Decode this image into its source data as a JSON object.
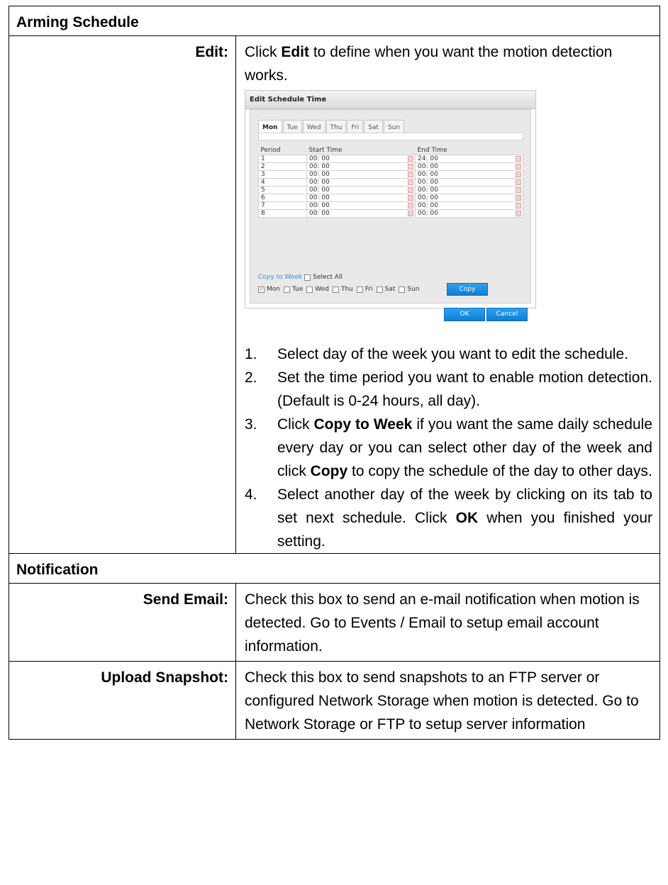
{
  "arming": {
    "header": "Arming Schedule",
    "edit_label": "Edit:",
    "edit_desc_pre": "Click ",
    "edit_desc_bold": "Edit",
    "edit_desc_post": " to define when you want the motion detection works.",
    "dialog": {
      "title": "Edit Schedule Time",
      "tabs": [
        "Mon",
        "Tue",
        "Wed",
        "Thu",
        "Fri",
        "Sat",
        "Sun"
      ],
      "active_tab": "Mon",
      "columns": [
        "Period",
        "Start Time",
        "End Time"
      ],
      "rows": [
        {
          "period": "1",
          "start": "00: 00",
          "end": "24: 00"
        },
        {
          "period": "2",
          "start": "00: 00",
          "end": "00: 00"
        },
        {
          "period": "3",
          "start": "00: 00",
          "end": "00: 00"
        },
        {
          "period": "4",
          "start": "00: 00",
          "end": "00: 00"
        },
        {
          "period": "5",
          "start": "00: 00",
          "end": "00: 00"
        },
        {
          "period": "6",
          "start": "00: 00",
          "end": "00: 00"
        },
        {
          "period": "7",
          "start": "00: 00",
          "end": "00: 00"
        },
        {
          "period": "8",
          "start": "00: 00",
          "end": "00: 00"
        }
      ],
      "copy_to_week": "Copy to Week",
      "select_all": "Select All",
      "days": [
        {
          "label": "Mon",
          "checked": true
        },
        {
          "label": "Tue",
          "checked": false
        },
        {
          "label": "Wed",
          "checked": false
        },
        {
          "label": "Thu",
          "checked": false
        },
        {
          "label": "Fri",
          "checked": false
        },
        {
          "label": "Sat",
          "checked": false
        },
        {
          "label": "Sun",
          "checked": false
        }
      ],
      "copy_button": "Copy",
      "ok_button": "OK",
      "cancel_button": "Cancel"
    },
    "steps": [
      {
        "num": "1.",
        "parts": [
          {
            "t": "Select day of the week you want to edit the schedule."
          }
        ]
      },
      {
        "num": "2.",
        "parts": [
          {
            "t": "Set the time period you want to enable motion detection. (Default is 0-24 hours, all day)."
          }
        ]
      },
      {
        "num": "3.",
        "parts": [
          {
            "t": "Click "
          },
          {
            "t": "Copy to Week",
            "b": true
          },
          {
            "t": " if you want the same daily schedule every day or you can select other day of the week and click "
          },
          {
            "t": "Copy",
            "b": true
          },
          {
            "t": " to copy the schedule of the day to other days."
          }
        ]
      },
      {
        "num": "4.",
        "parts": [
          {
            "t": "Select another day of the week by clicking on its tab to set next schedule. Click "
          },
          {
            "t": "OK",
            "b": true
          },
          {
            "t": " when you finished your setting."
          }
        ]
      }
    ]
  },
  "notification": {
    "header": "Notification",
    "send_email_label": "Send Email:",
    "send_email_desc": "Check this box to send an e-mail notification when motion is detected. Go to Events / Email to setup email account information.",
    "upload_label": "Upload Snapshot:",
    "upload_desc": "Check this box to send snapshots to an FTP server or configured Network Storage when motion is detected. Go to Network Storage or FTP to setup server information"
  }
}
